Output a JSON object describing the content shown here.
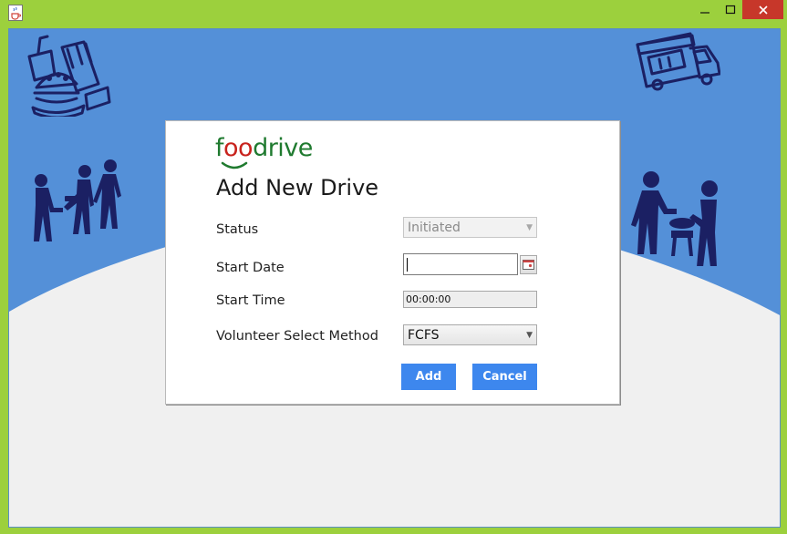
{
  "colors": {
    "frame": "#9cd03d",
    "banner": "#5490d8",
    "icon_stroke": "#1b2063",
    "primary_button": "#3d87ee",
    "close_button": "#c7372a",
    "logo_green": "#1f7a2f",
    "logo_red": "#c8231d"
  },
  "window": {
    "minimize_glyph": "—",
    "maximize_glyph": "☐",
    "close_glyph": "✕",
    "app_icon": "java-cup-icon"
  },
  "logo": {
    "part1": "f",
    "part2": "oo",
    "part3": "drive"
  },
  "form": {
    "heading": "Add New Drive",
    "status_label": "Status",
    "status_value": "Initiated",
    "start_date_label": "Start Date",
    "start_date_value": "",
    "start_time_label": "Start Time",
    "start_time_value": "00:00:00",
    "volunteer_method_label": "Volunteer Select Method",
    "volunteer_method_value": "FCFS",
    "add_button": "Add",
    "cancel_button": "Cancel"
  },
  "illustrations": [
    "fast-food-icon",
    "food-truck-icon",
    "volunteers-group-icon",
    "food-serving-icon"
  ]
}
